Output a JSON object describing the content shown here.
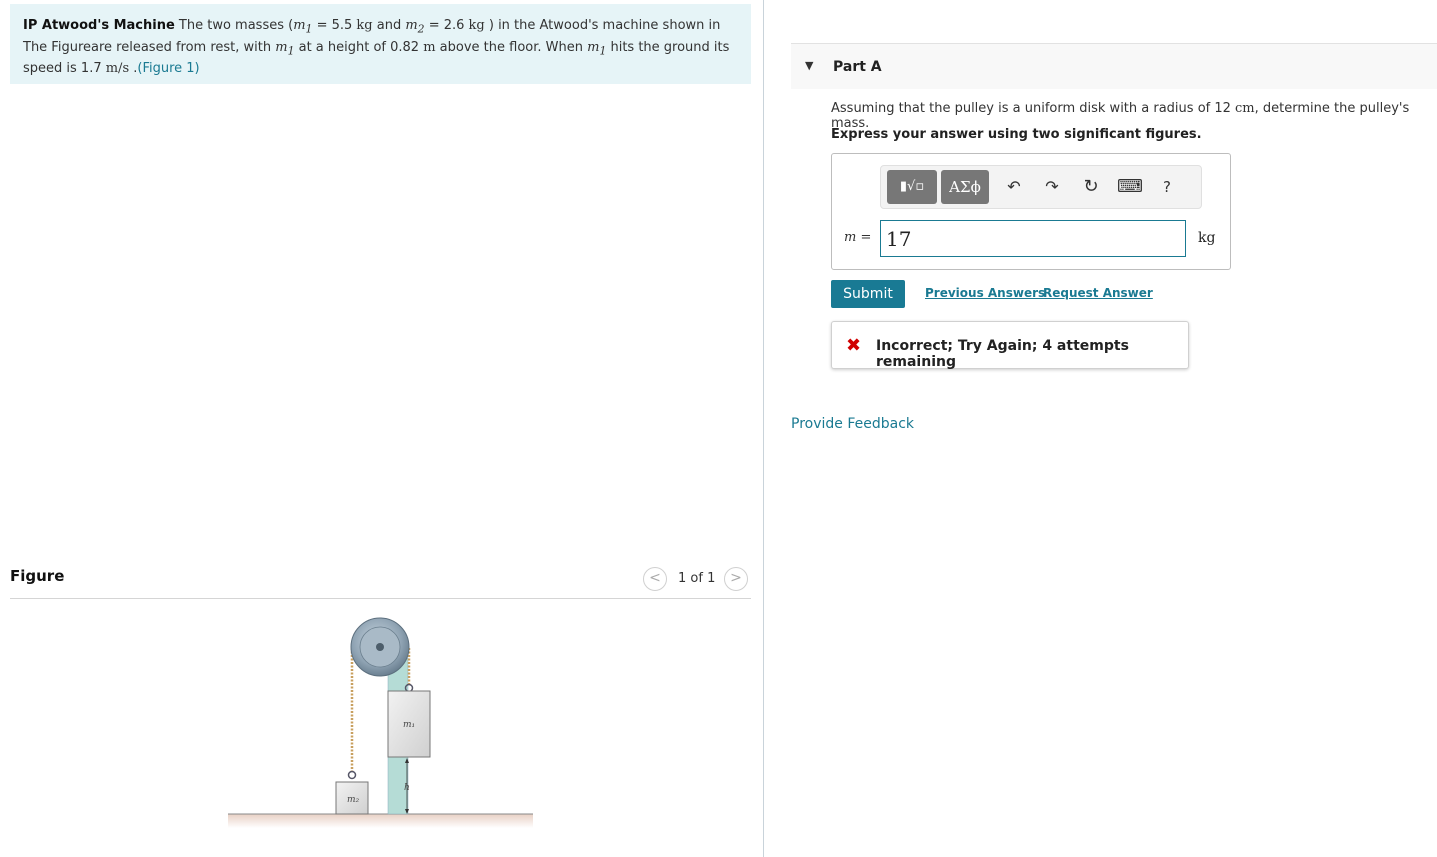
{
  "problem": {
    "title": "IP Atwood's Machine",
    "t1": " The two masses (",
    "m1_sym": "m",
    "m1_sub": "1",
    "eq1": " = 5.5 ",
    "kg1": "kg",
    "and": " and ",
    "m2_sym": "m",
    "m2_sub": "2",
    "eq2": " = 2.6 ",
    "kg2": "kg",
    "t2": " ) in the Atwood's machine shown in The Figureare released from rest, with ",
    "m1b_sym": "m",
    "m1b_sub": "1",
    "t3": " at a height of 0.82 ",
    "meter": "m",
    "t4": " above the floor. When ",
    "m1c_sym": "m",
    "m1c_sub": "1",
    "t5": " hits the ground its speed is 1.7 ",
    "speed_unit": "m/s",
    "t6": " .",
    "figure_link": "(Figure 1)"
  },
  "figure": {
    "header": "Figure",
    "prev": "<",
    "next": ">",
    "page_count": "1 of 1",
    "label_m1": "m₁",
    "label_m2": "m₂",
    "label_h": "h"
  },
  "part": {
    "caret": "▼",
    "title": "Part A",
    "question_a": "Assuming that the pulley is a uniform disk with a radius of 12 ",
    "question_unit": "cm",
    "question_b": ", determine the pulley's mass.",
    "instruction": "Express your answer using two significant figures."
  },
  "answer": {
    "toolbar": {
      "template_btn": "▮√▫",
      "greek_btn": "ΑΣϕ",
      "undo_icon": "↶",
      "redo_icon": "↷",
      "reset_icon": "↻",
      "keyboard_icon": "⌨",
      "help_icon": "?"
    },
    "variable": "m =",
    "value": "17",
    "unit": "kg"
  },
  "actions": {
    "submit": "Submit",
    "previous_answers": "Previous Answers",
    "request_answer": "Request Answer"
  },
  "feedback": {
    "icon": "✖",
    "message": "Incorrect; Try Again; 4 attempts remaining"
  },
  "provide_feedback": "Provide Feedback",
  "colors": {
    "accent": "#197a94",
    "problem_bg": "#e6f4f7",
    "error": "#d00000"
  }
}
